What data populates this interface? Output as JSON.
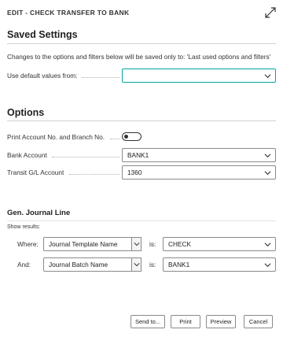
{
  "dialog": {
    "title": "EDIT - CHECK TRANSFER TO BANK",
    "expand_icon": "expand-arrows-icon"
  },
  "saved_settings": {
    "heading": "Saved Settings",
    "note": "Changes to the options and filters below will be saved only to: 'Last used options and filters'",
    "default_label": "Use default values from:",
    "default_value": ""
  },
  "options": {
    "heading": "Options",
    "print_account_label": "Print Account No. and Branch No.",
    "print_account_on": false,
    "bank_account_label": "Bank Account",
    "bank_account_value": "BANK1",
    "transit_label": "Transit G/L Account",
    "transit_value": "1360"
  },
  "journal_line": {
    "heading": "Gen. Journal Line",
    "show_results": "Show results:",
    "filters": [
      {
        "connector": "Where:",
        "field": "Journal Template Name",
        "is_label": "is:",
        "value": "CHECK"
      },
      {
        "connector": "And:",
        "field": "Journal Batch Name",
        "is_label": "is:",
        "value": "BANK1"
      }
    ]
  },
  "footer": {
    "send_to": "Send to...",
    "print": "Print",
    "preview": "Preview",
    "cancel": "Cancel"
  },
  "colors": {
    "focus_border": "#00a3a3",
    "border": "#8a8a8a"
  }
}
